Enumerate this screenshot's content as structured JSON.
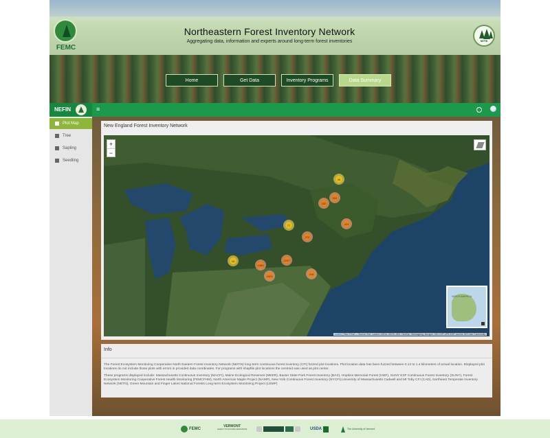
{
  "header": {
    "logo_text": "FEMC",
    "title": "Northeastern Forest Inventory Network",
    "subtitle": "Aggregating data, information and experts around long-term forest inventories",
    "badge_text": "NEFIN",
    "nav": [
      {
        "label": "Home",
        "active": false
      },
      {
        "label": "Get Data",
        "active": false
      },
      {
        "label": "Inventory Programs",
        "active": false
      },
      {
        "label": "Data Summary",
        "active": true
      }
    ]
  },
  "app": {
    "brand": "NEFIN",
    "menu_icon": "hamburger-icon",
    "sidebar": [
      {
        "label": "Plot Map",
        "icon": "map-icon",
        "active": true
      },
      {
        "label": "Tree",
        "icon": "tree-icon",
        "active": false
      },
      {
        "label": "Sapling",
        "icon": "sapling-icon",
        "active": false
      },
      {
        "label": "Seedling",
        "icon": "seedling-icon",
        "active": false
      }
    ]
  },
  "map_panel": {
    "title": "New England Forest Inventory Network",
    "zoom_in": "+",
    "zoom_out": "−",
    "minimap_labels": "NORTH AMERICA",
    "attribution_link": "Leaflet",
    "attribution_text": " | Tiles © Esri — Source: Esri, i-cubed, USDA, USGS, AEX, GeoEye, Getmapping, Aerogrid, IGN, IGP, UPR-EGP, and the GIS User Community",
    "clusters": [
      {
        "label": "46",
        "color": "yellow"
      },
      {
        "label": "534",
        "color": "orange"
      },
      {
        "label": "330",
        "color": "orange"
      },
      {
        "label": "424",
        "color": "orange"
      },
      {
        "label": "77",
        "color": "yellow"
      },
      {
        "label": "270",
        "color": "orange"
      },
      {
        "label": "16",
        "color": "yellow"
      },
      {
        "label": "1063",
        "color": "orange"
      },
      {
        "label": "2247",
        "color": "orange"
      },
      {
        "label": "2023",
        "color": "orange"
      },
      {
        "label": "218",
        "color": "orange"
      }
    ]
  },
  "info_panel": {
    "title": "Info",
    "text_1": "The Forest Ecosystem Monitoring Cooperative North Eastern Forest Inventory Network (NEFIN) long-term continuous forest inventory (CFI) fuzzed plot locations. Plot location data has been fuzzed between 0.14 to 1.4 kilometers of actual location. Displayed plot locations do not include those plots with errors in provided data coordinates. For programs with shapfile plot locations the centroid was used as plot center.",
    "text_2": "These programs displayed include: Massachusetts Continuous Inventory (MACFI), Maine Ecological Reserves (MEER), Baxter State Park Forest Inventory (BAX), Hopkins Memorial Forest (HMF), SUNY ESF Continuous Forest Inventory (SUNY), Forest Ecosystem Monitoring Cooperative Forest Health Monitoring (FEMCFHM), North American Maple Project (NAMP), New York Continuous Forest Inventory (NYCFI),University of Massachusetts Cadwell and Mt Toby CFI (CAD), Northeast Temperate Inventory Network (NETN), Green Mountain and Finger Lakes National Forests Long-term Ecosystem Monitoring Project (LEMP)"
  },
  "footer": {
    "logos": [
      {
        "name": "FEMC",
        "text": "FEMC"
      },
      {
        "name": "Vermont",
        "text": "VERMONT",
        "sub": "AGENCY OF NATURAL RESOURCES"
      },
      {
        "name": "USDA",
        "text": "USDA"
      },
      {
        "name": "UVM",
        "text": "The University of Vermont"
      }
    ]
  }
}
